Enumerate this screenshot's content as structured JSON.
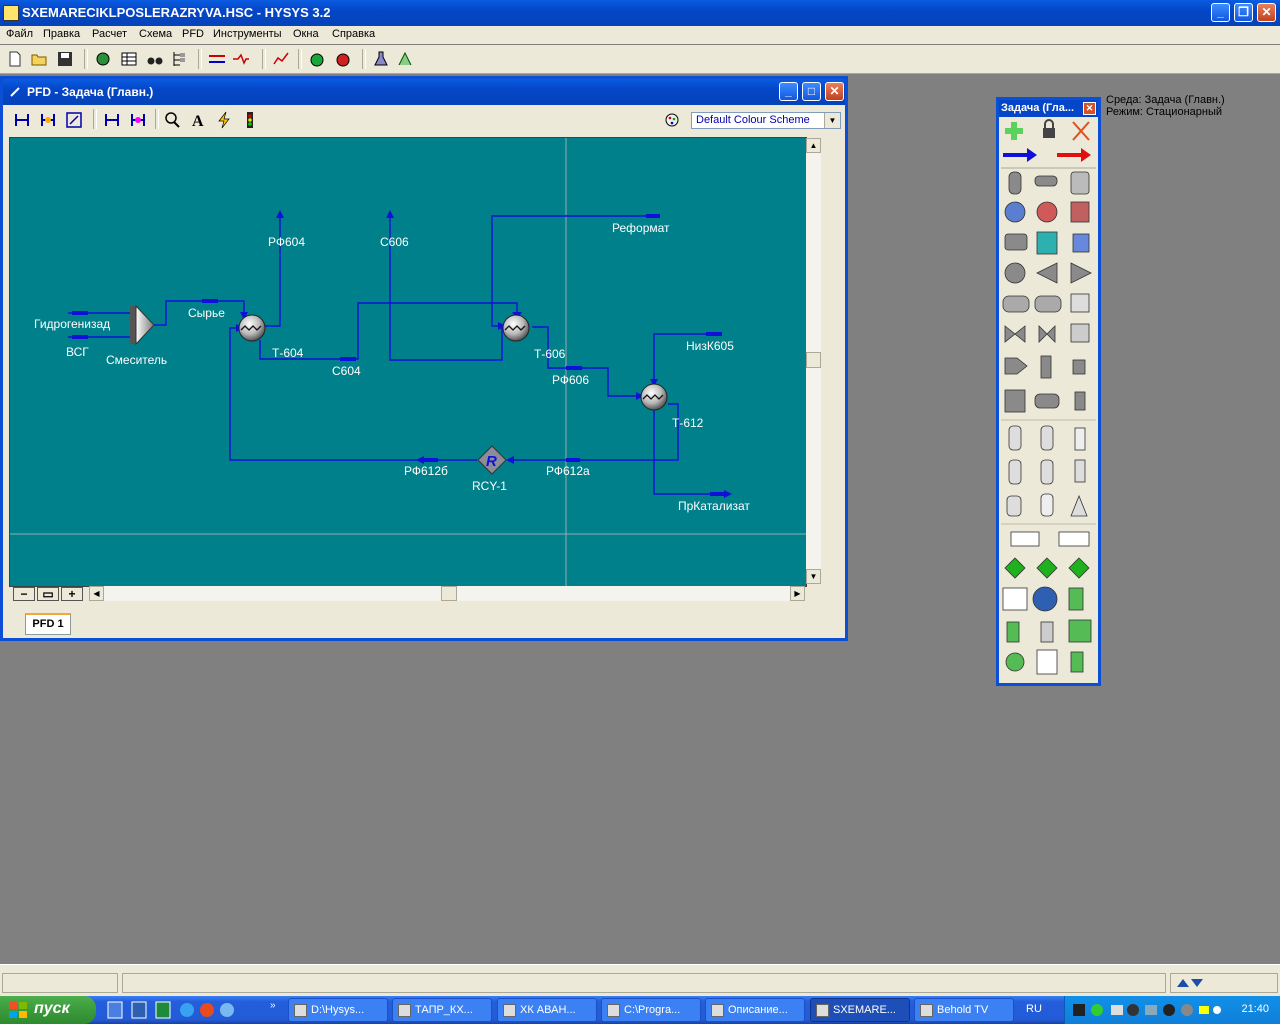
{
  "app": {
    "title": "SXEMARECIKLPOSLERAZRYVA.HSC - HYSYS 3.2"
  },
  "menu": [
    "Файл",
    "Правка",
    "Расчет",
    "Схема",
    "PFD",
    "Инструменты",
    "Окна",
    "Справка"
  ],
  "env": {
    "line1": "Среда: Задача (Главн.)",
    "line2": "Режим: Стационарный"
  },
  "pfd": {
    "title": "PFD - Задача (Главн.)",
    "colour_scheme": "Default Colour Scheme",
    "tab": "PFD 1",
    "labels": {
      "rf604": "РФ604",
      "s606": "С606",
      "reformat": "Реформат",
      "gidrogenizad": "Гидрогенизад",
      "vsg": "ВСГ",
      "smesitel": "Смеситель",
      "syrye": "Сырье",
      "t604": "Т-604",
      "s604": "С604",
      "t606": "Т-606",
      "rf606": "РФ606",
      "nizk605": "НизК605",
      "t612": "Т-612",
      "rf612b": "РФ612б",
      "rf612a": "РФ612а",
      "rcy1": "RCY-1",
      "rcy_letter": "R",
      "prkatalizat": "ПрКатализат"
    }
  },
  "palette": {
    "title": "Задача (Гла..."
  },
  "taskbar": {
    "start": "пуск",
    "tasks": [
      "D:\\Hysys...",
      "ТАПР_КХ...",
      "ХК АВАН...",
      "C:\\Progra...",
      "Описание...",
      "SXEMARE...",
      "Behold TV"
    ],
    "lang": "RU",
    "clock": "21:40"
  }
}
